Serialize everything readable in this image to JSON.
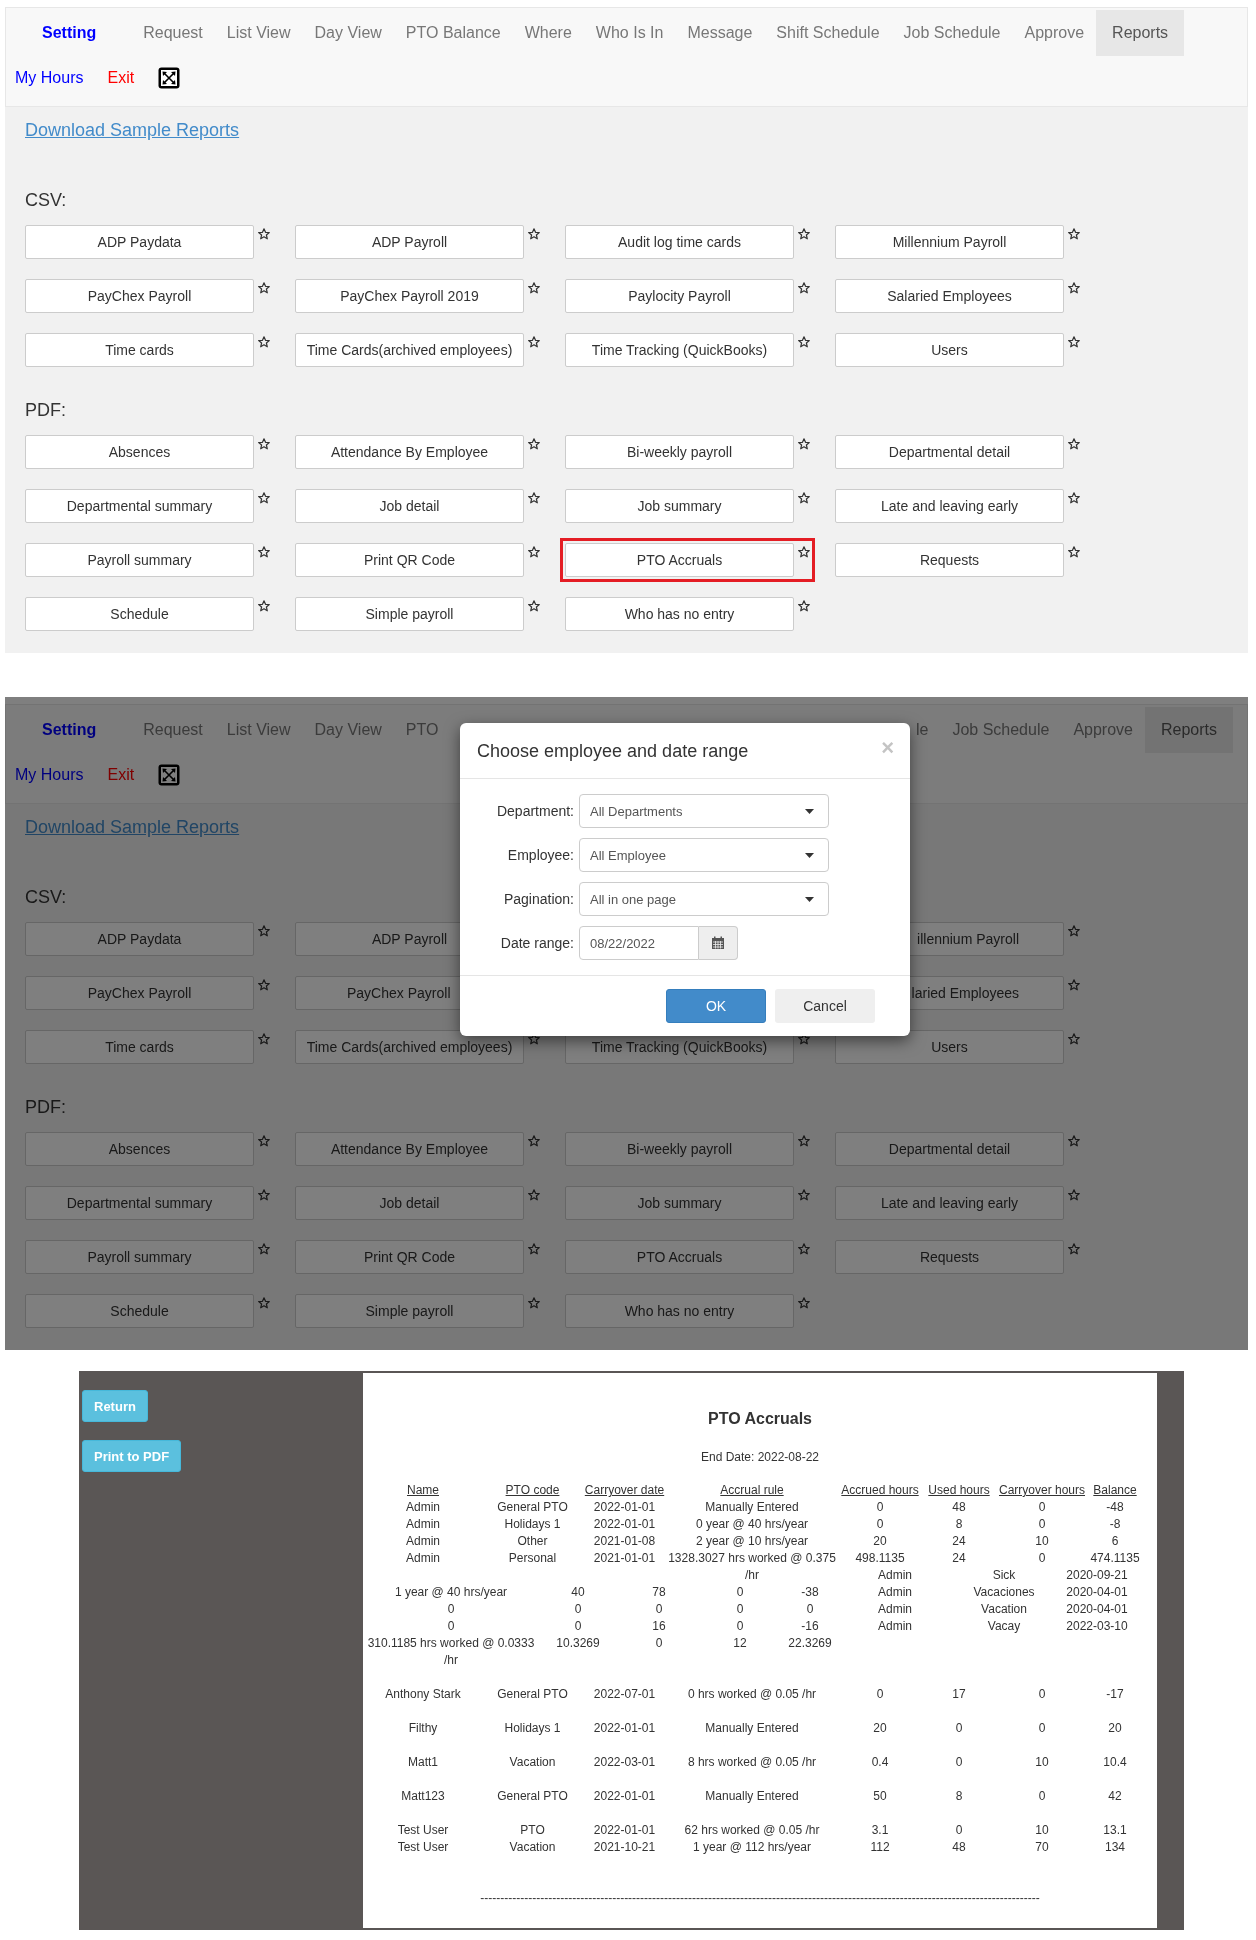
{
  "reports_page": {
    "nav": {
      "items": [
        {
          "label": "Setting",
          "kind": "brand",
          "selected": false
        },
        {
          "label": "Request",
          "kind": "tab",
          "selected": false
        },
        {
          "label": "List View",
          "kind": "tab",
          "selected": false
        },
        {
          "label": "Day View",
          "kind": "tab",
          "selected": false
        },
        {
          "label": "PTO Balance",
          "kind": "tab",
          "selected": false
        },
        {
          "label": "Where",
          "kind": "tab",
          "selected": false
        },
        {
          "label": "Who Is In",
          "kind": "tab",
          "selected": false
        },
        {
          "label": "Message",
          "kind": "tab",
          "selected": false
        },
        {
          "label": "Shift Schedule",
          "kind": "tab",
          "selected": false
        },
        {
          "label": "Job Schedule",
          "kind": "tab",
          "selected": false
        },
        {
          "label": "Approve",
          "kind": "tab",
          "selected": false
        },
        {
          "label": "Reports",
          "kind": "tab",
          "selected": true
        }
      ],
      "links": [
        {
          "label": "My Hours",
          "kind": "link"
        },
        {
          "label": "Exit",
          "kind": "exit"
        }
      ]
    },
    "download_link": "Download Sample Reports",
    "sections": [
      {
        "heading": "CSV:",
        "items": [
          {
            "label": "ADP Paydata",
            "star": true,
            "highlighted": false
          },
          {
            "label": "ADP Payroll",
            "star": true,
            "highlighted": false
          },
          {
            "label": "Audit log time cards",
            "star": true,
            "highlighted": false
          },
          {
            "label": "Millennium Payroll",
            "star": true,
            "highlighted": false
          },
          {
            "label": "PayChex Payroll",
            "star": true,
            "highlighted": false
          },
          {
            "label": "PayChex Payroll 2019",
            "star": true,
            "highlighted": false
          },
          {
            "label": "Paylocity Payroll",
            "star": true,
            "highlighted": false
          },
          {
            "label": "Salaried Employees",
            "star": true,
            "highlighted": false
          },
          {
            "label": "Time cards",
            "star": true,
            "highlighted": false
          },
          {
            "label": "Time Cards(archived employees)",
            "star": true,
            "highlighted": false
          },
          {
            "label": "Time Tracking (QuickBooks)",
            "star": true,
            "highlighted": false
          },
          {
            "label": "Users",
            "star": true,
            "highlighted": false
          }
        ]
      },
      {
        "heading": "PDF:",
        "items": [
          {
            "label": "Absences",
            "star": true,
            "highlighted": false
          },
          {
            "label": "Attendance By Employee",
            "star": true,
            "highlighted": false
          },
          {
            "label": "Bi-weekly payroll",
            "star": true,
            "highlighted": false
          },
          {
            "label": "Departmental detail",
            "star": true,
            "highlighted": false
          },
          {
            "label": "Departmental summary",
            "star": true,
            "highlighted": false
          },
          {
            "label": "Job detail",
            "star": true,
            "highlighted": false
          },
          {
            "label": "Job summary",
            "star": true,
            "highlighted": false
          },
          {
            "label": "Late and leaving early",
            "star": true,
            "highlighted": false
          },
          {
            "label": "Payroll summary",
            "star": true,
            "highlighted": false
          },
          {
            "label": "Print QR Code",
            "star": true,
            "highlighted": false
          },
          {
            "label": "PTO Accruals",
            "star": true,
            "highlighted": true
          },
          {
            "label": "Requests",
            "star": true,
            "highlighted": false
          },
          {
            "label": "Schedule",
            "star": true,
            "highlighted": false
          },
          {
            "label": "Simple payroll",
            "star": true,
            "highlighted": false
          },
          {
            "label": "Who has no entry",
            "star": true,
            "highlighted": false
          }
        ]
      }
    ]
  },
  "reports_page_with_dialog": {
    "nav": {
      "items": [
        {
          "label": "Setting",
          "kind": "brand",
          "selected": false
        },
        {
          "label": "Request",
          "kind": "tab",
          "selected": false
        },
        {
          "label": "List View",
          "kind": "tab",
          "selected": false
        },
        {
          "label": "Day View",
          "kind": "tab",
          "selected": false
        },
        {
          "label": "PTO",
          "kind": "tab",
          "selected": false
        }
      ],
      "items_end": [
        {
          "label": "le",
          "kind": "tab",
          "selected": false
        },
        {
          "label": "Job Schedule",
          "kind": "tab",
          "selected": false
        },
        {
          "label": "Approve",
          "kind": "tab",
          "selected": false
        },
        {
          "label": "Reports",
          "kind": "tab",
          "selected": true
        }
      ],
      "links": [
        {
          "label": "My Hours",
          "kind": "link"
        },
        {
          "label": "Exit",
          "kind": "exit"
        }
      ]
    },
    "download_link": "Download Sample Reports",
    "sections": [
      {
        "heading": "CSV:",
        "items": [
          {
            "kind": "full",
            "label": "ADP Paydata",
            "star": true
          },
          {
            "kind": "full",
            "label": "ADP Payroll",
            "star": false
          },
          {
            "kind": "hidden"
          },
          {
            "kind": "clipped",
            "label": "illennium Payroll",
            "star": true
          },
          {
            "kind": "full",
            "label": "PayChex Payroll",
            "star": true
          },
          {
            "kind": "clipped",
            "label": "PayChex Payroll",
            "star": false
          },
          {
            "kind": "hidden"
          },
          {
            "kind": "clipped",
            "label": "laried Employees",
            "star": true
          },
          {
            "kind": "full",
            "label": "Time cards",
            "star": true
          },
          {
            "kind": "full",
            "label": "Time Cards(archived employees)",
            "star": true
          },
          {
            "kind": "full",
            "label": "Time Tracking (QuickBooks)",
            "star": true
          },
          {
            "kind": "full",
            "label": "Users",
            "star": true
          }
        ]
      },
      {
        "heading": "PDF:",
        "items": [
          {
            "label": "Absences",
            "star": true
          },
          {
            "label": "Attendance By Employee",
            "star": true
          },
          {
            "label": "Bi-weekly payroll",
            "star": true
          },
          {
            "label": "Departmental detail",
            "star": true
          },
          {
            "label": "Departmental summary",
            "star": true
          },
          {
            "label": "Job detail",
            "star": true
          },
          {
            "label": "Job summary",
            "star": true
          },
          {
            "label": "Late and leaving early",
            "star": true
          },
          {
            "label": "Payroll summary",
            "star": true
          },
          {
            "label": "Print QR Code",
            "star": true
          },
          {
            "label": "PTO Accruals",
            "star": true
          },
          {
            "label": "Requests",
            "star": true
          },
          {
            "label": "Schedule",
            "star": true
          },
          {
            "label": "Simple payroll",
            "star": true
          },
          {
            "label": "Who has no entry",
            "star": true
          }
        ]
      }
    ],
    "dialog": {
      "title": "Choose employee and date range",
      "close": "×",
      "fields": [
        {
          "label": "Department:",
          "kind": "select",
          "value": "All Departments"
        },
        {
          "label": "Employee:",
          "kind": "select",
          "value": "All Employee"
        },
        {
          "label": "Pagination:",
          "kind": "select",
          "value": "All in one page"
        },
        {
          "label": "Date range:",
          "kind": "date",
          "value": "08/22/2022"
        }
      ],
      "buttons": [
        {
          "label": "OK",
          "kind": "primary"
        },
        {
          "label": "Cancel",
          "kind": "default"
        }
      ]
    }
  },
  "report_viewer": {
    "buttons": [
      "Return",
      "Print to PDF"
    ],
    "report": {
      "title": "PTO Accruals",
      "end_date": "End Date: 2022-08-22",
      "columns": [
        "Name",
        "PTO code",
        "Carryover date",
        "Accrual rule",
        "Accrued hours",
        "Used hours",
        "Carryover hours",
        "Balance"
      ],
      "blocks": [
        {
          "kind": "aligned",
          "rows": [
            [
              "Admin",
              "General PTO",
              "2022-01-01",
              "Manually Entered",
              "0",
              "48",
              "0",
              "-48"
            ],
            [
              "Admin",
              "Holidays 1",
              "2022-01-01",
              "0 year @ 40 hrs/year",
              "0",
              "8",
              "0",
              "-8"
            ],
            [
              "Admin",
              "Other",
              "2021-01-08",
              "2 year @ 10 hrs/year",
              "20",
              "24",
              "10",
              "6"
            ],
            [
              "Admin",
              "Personal",
              "2021-01-01",
              "1328.3027 hrs worked @ 0.375 /hr",
              "498.1135",
              "24",
              "0",
              "474.1135"
            ]
          ]
        },
        {
          "kind": "shifted",
          "rows": [
            [
              "",
              "",
              "",
              "",
              "",
              "Admin",
              "Sick",
              "2020-09-21"
            ],
            [
              "1 year @ 40 hrs/year",
              "40",
              "78",
              "0",
              "-38",
              "Admin",
              "Vacaciones",
              "2020-04-01"
            ],
            [
              "0",
              "0",
              "0",
              "0",
              "0",
              "Admin",
              "Vacation",
              "2020-04-01"
            ],
            [
              "0",
              "0",
              "16",
              "0",
              "-16",
              "Admin",
              "Vacay",
              "2022-03-10"
            ],
            [
              "310.1185 hrs worked @ 0.0333 /hr",
              "10.3269",
              "0",
              "12",
              "22.3269"
            ]
          ]
        },
        {
          "kind": "aligned",
          "rows": [
            [
              "Anthony Stark",
              "General PTO",
              "2022-07-01",
              "0 hrs worked @ 0.05 /hr",
              "0",
              "17",
              "0",
              "-17"
            ]
          ]
        },
        {
          "kind": "aligned",
          "rows": [
            [
              "Filthy",
              "Holidays 1",
              "2022-01-01",
              "Manually Entered",
              "20",
              "0",
              "0",
              "20"
            ]
          ]
        },
        {
          "kind": "aligned",
          "rows": [
            [
              "Matt1",
              "Vacation",
              "2022-03-01",
              "8 hrs worked @ 0.05 /hr",
              "0.4",
              "0",
              "10",
              "10.4"
            ]
          ]
        },
        {
          "kind": "aligned",
          "rows": [
            [
              "Matt123",
              "General PTO",
              "2022-01-01",
              "Manually Entered",
              "50",
              "8",
              "0",
              "42"
            ]
          ]
        },
        {
          "kind": "aligned",
          "rows": [
            [
              "Test User",
              "PTO",
              "2022-01-01",
              "62 hrs worked @ 0.05 /hr",
              "3.1",
              "0",
              "10",
              "13.1"
            ],
            [
              "Test User",
              "Vacation",
              "2021-10-21",
              "1 year @ 112 hrs/year",
              "112",
              "48",
              "70",
              "134"
            ]
          ]
        }
      ],
      "footer_rule": "--------------------------------------------------------------------------------------------------------------------------------------------"
    }
  }
}
